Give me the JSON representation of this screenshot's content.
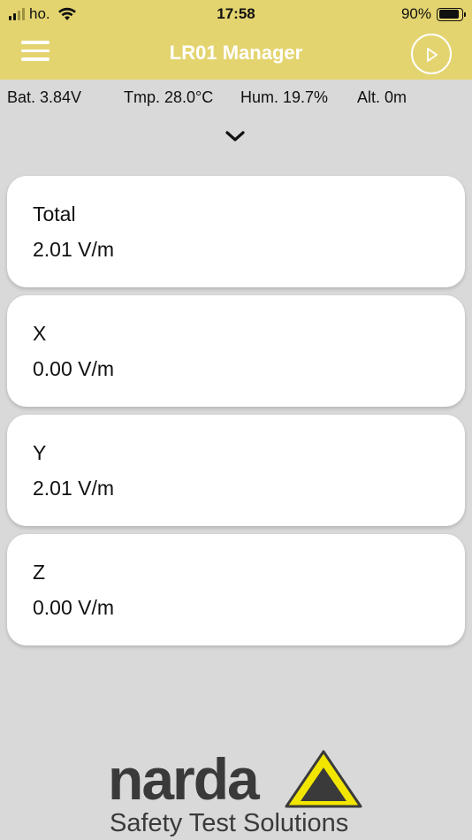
{
  "status_bar": {
    "carrier": "ho.",
    "time": "17:58",
    "battery_percent": "90%",
    "battery_level": 0.9
  },
  "header": {
    "title": "LR01 Manager",
    "menu_icon": "hamburger-menu-icon",
    "play_icon": "play-circle-icon",
    "color": "#e4d470"
  },
  "info": {
    "battery": "Bat. 3.84V",
    "temperature": "Tmp. 28.0°C",
    "humidity": "Hum. 19.7%",
    "altitude": "Alt. 0m"
  },
  "measurements": [
    {
      "label": "Total",
      "value": "2.01 V/m"
    },
    {
      "label": "X",
      "value": "0.00 V/m"
    },
    {
      "label": "Y",
      "value": "2.01 V/m"
    },
    {
      "label": "Z",
      "value": "0.00 V/m"
    }
  ],
  "logo": {
    "brand": "narda",
    "tagline": "Safety Test Solutions",
    "accent": "#f2e600"
  }
}
